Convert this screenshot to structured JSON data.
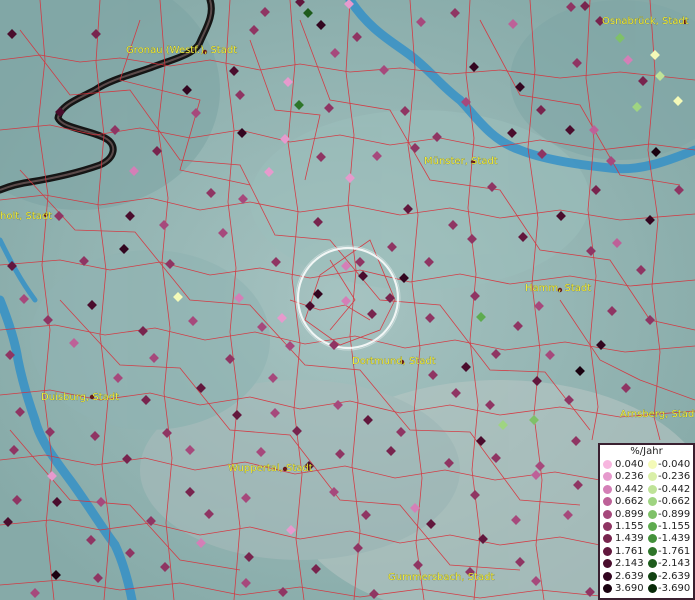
{
  "map": {
    "cities": [
      {
        "name": "Gronau (Westf.), Stadt"
      },
      {
        "name": "Osnabrück, Stadt"
      },
      {
        "name": "Münster, Stadt"
      },
      {
        "name": "holt, Stadt"
      },
      {
        "name": "Hamm, Stadt"
      },
      {
        "name": "Dortmund, Stadt"
      },
      {
        "name": "Duisburg, Stadt"
      },
      {
        "name": "Arnsberg, Stadt"
      },
      {
        "name": "Wuppertal, Stadt"
      },
      {
        "name": "Gummersbach, Stadt"
      }
    ],
    "colors": {
      "background": "#8fb2b0",
      "borders": "#d8303a",
      "rivers": "#2f8fc8",
      "state_border": "#151515",
      "label_text": "#f2ee3a",
      "highlight_ring": "#ffffff"
    }
  },
  "legend": {
    "title": "%/Jahr",
    "rows": [
      {
        "pos": "0.040",
        "pos_color": "#f7b6df",
        "neg": "-0.040",
        "neg_color": "#f4fab8"
      },
      {
        "pos": "0.236",
        "pos_color": "#e69acd",
        "neg": "-0.236",
        "neg_color": "#d9efa8"
      },
      {
        "pos": "0.442",
        "pos_color": "#d47fb7",
        "neg": "-0.442",
        "neg_color": "#bfe398"
      },
      {
        "pos": "0.662",
        "pos_color": "#bd6198",
        "neg": "-0.662",
        "neg_color": "#9fd481"
      },
      {
        "pos": "0.899",
        "pos_color": "#a6497c",
        "neg": "-0.899",
        "neg_color": "#7fc168"
      },
      {
        "pos": "1.155",
        "pos_color": "#8f3563",
        "neg": "-1.155",
        "neg_color": "#5eab4f"
      },
      {
        "pos": "1.439",
        "pos_color": "#78244e",
        "neg": "-1.439",
        "neg_color": "#43913a"
      },
      {
        "pos": "1.761",
        "pos_color": "#62173d",
        "neg": "-1.761",
        "neg_color": "#2e7529"
      },
      {
        "pos": "2.143",
        "pos_color": "#4a0d2d",
        "neg": "-2.143",
        "neg_color": "#1e5b1c"
      },
      {
        "pos": "2.639",
        "pos_color": "#330620",
        "neg": "-2.639",
        "neg_color": "#124212"
      },
      {
        "pos": "3.690",
        "pos_color": "#1a0210",
        "neg": "-3.690",
        "neg_color": "#072a08"
      }
    ]
  }
}
